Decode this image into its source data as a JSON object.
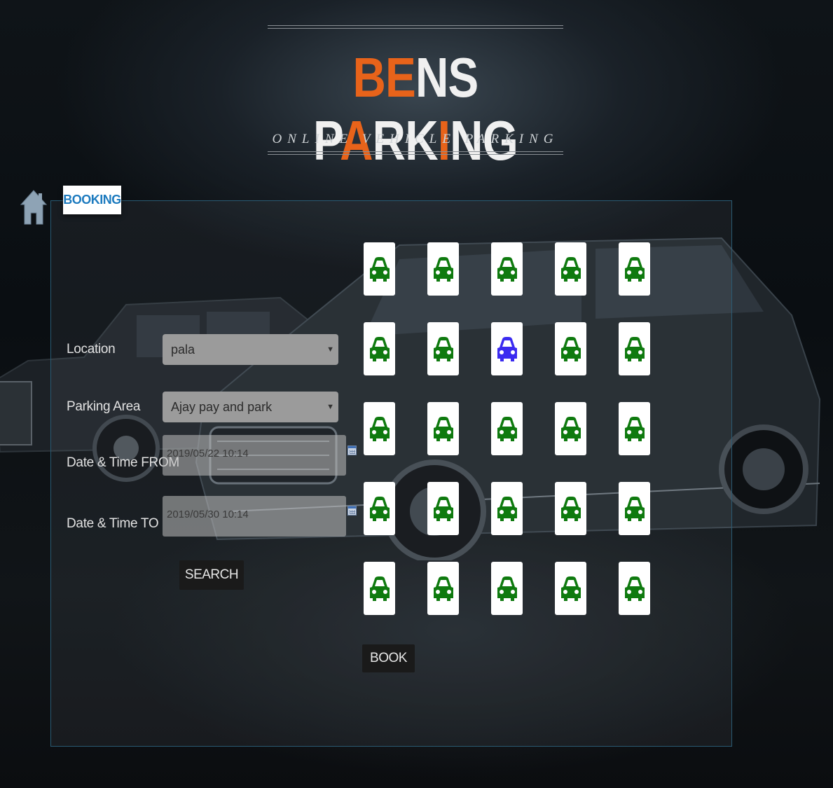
{
  "header": {
    "title_parts": [
      {
        "text": "BE",
        "accent": true
      },
      {
        "text": "N",
        "accent": false
      },
      {
        "text": "S P",
        "accent": false
      },
      {
        "text": "A",
        "accent": true
      },
      {
        "text": "RK",
        "accent": false
      },
      {
        "text": "I",
        "accent": true
      },
      {
        "text": "NG",
        "accent": false
      }
    ],
    "subtitle": "ONLINE VEHICLE PARKING"
  },
  "nav": {
    "home_icon": "home-icon",
    "tab_label": "BOOKING"
  },
  "form": {
    "location_label": "Location",
    "location_value": "pala",
    "parking_area_label": "Parking Area",
    "parking_area_value": "Ajay pay and park",
    "from_label": "Date & Time FROM",
    "from_value": "2019/05/22 10:14",
    "to_label": "Date & Time TO",
    "to_value": "2019/05/30 10:14",
    "search_label": "SEARCH"
  },
  "slots": {
    "rows": 5,
    "cols": 5,
    "available_color": "#0f7a0f",
    "selected_color": "#3b2bf0",
    "states": [
      [
        "available",
        "available",
        "available",
        "available",
        "available"
      ],
      [
        "available",
        "available",
        "selected",
        "available",
        "available"
      ],
      [
        "available",
        "available",
        "available",
        "available",
        "available"
      ],
      [
        "available",
        "available",
        "available",
        "available",
        "available"
      ],
      [
        "available",
        "available",
        "available",
        "available",
        "available"
      ]
    ]
  },
  "book_label": "BOOK",
  "colors": {
    "accent": "#e8631a",
    "tab_text": "#1d7bbf",
    "panel_border": "#2a5a72"
  }
}
